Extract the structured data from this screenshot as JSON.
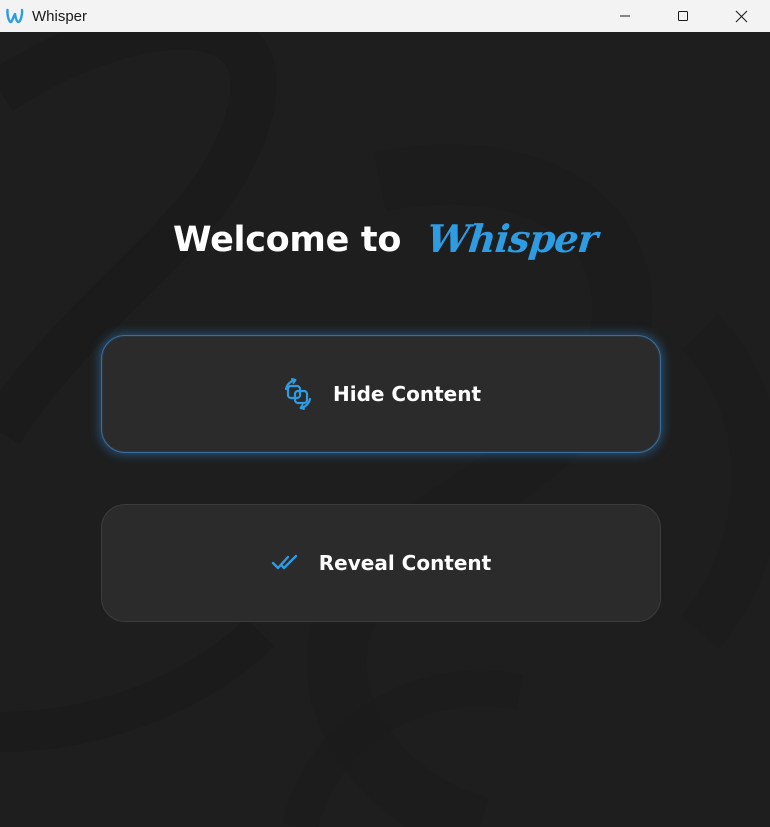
{
  "window": {
    "title": "Whisper",
    "app_icon": "whisper-w-logo-icon",
    "controls": [
      "minimize-icon",
      "maximize-icon",
      "close-icon"
    ]
  },
  "main": {
    "welcome_text": "Welcome to",
    "brand_text": "Whisper",
    "hide_button": {
      "label": "Hide Content",
      "icon": "transform-swap-icon"
    },
    "reveal_button": {
      "label": "Reveal Content",
      "icon": "double-check-icon"
    }
  },
  "colors": {
    "background": "#1e1e1e",
    "accent": "#2d9ce3",
    "button_bg": "#2b2b2b",
    "titlebar": "#f3f3f3"
  }
}
